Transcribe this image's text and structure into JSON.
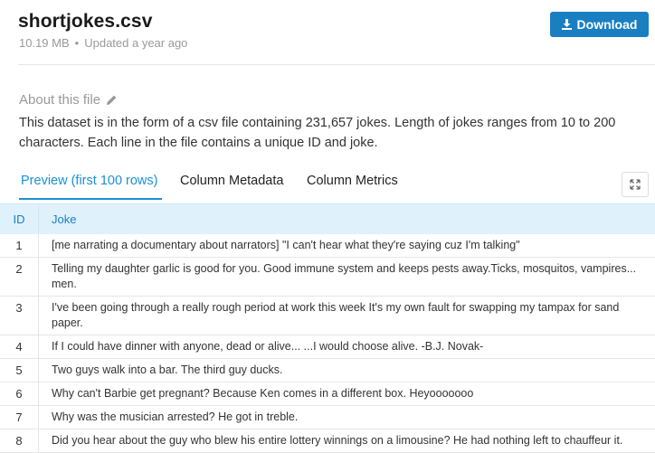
{
  "file": {
    "title": "shortjokes.csv",
    "size": "10.19 MB",
    "separator": "•",
    "updated": "Updated a year ago"
  },
  "download": {
    "label": "Download",
    "icon": "download-icon"
  },
  "about": {
    "heading": "About this file",
    "icon": "pencil-icon",
    "text": "This dataset is in the form of a csv file containing 231,657 jokes. Length of jokes ranges from 10 to 200 characters. Each line in the file contains a unique ID and joke."
  },
  "tabs": [
    {
      "label": "Preview (first 100 rows)",
      "active": true
    },
    {
      "label": "Column Metadata",
      "active": false
    },
    {
      "label": "Column Metrics",
      "active": false
    }
  ],
  "table": {
    "columns": [
      "ID",
      "Joke"
    ],
    "rows": [
      {
        "id": "1",
        "joke": "[me narrating a documentary about narrators] \"I can't hear what they're saying cuz I'm talking\""
      },
      {
        "id": "2",
        "joke": "Telling my daughter garlic is good for you. Good immune system and keeps pests away.Ticks, mosquitos, vampires... men."
      },
      {
        "id": "3",
        "joke": "I've been going through a really rough period at work this week It's my own fault for swapping my tampax for sand paper."
      },
      {
        "id": "4",
        "joke": "If I could have dinner with anyone, dead or alive... ...I would choose alive. -B.J. Novak-"
      },
      {
        "id": "5",
        "joke": "Two guys walk into a bar. The third guy ducks."
      },
      {
        "id": "6",
        "joke": "Why can't Barbie get pregnant? Because Ken comes in a different box. Heyooooooo"
      },
      {
        "id": "7",
        "joke": "Why was the musician arrested? He got in treble."
      },
      {
        "id": "8",
        "joke": "Did you hear about the guy who blew his entire lottery winnings on a limousine? He had nothing left to chauffeur it."
      }
    ]
  },
  "colors": {
    "accent": "#1a90d8",
    "button": "#1a7fc1",
    "header_row": "#dff1fb"
  }
}
